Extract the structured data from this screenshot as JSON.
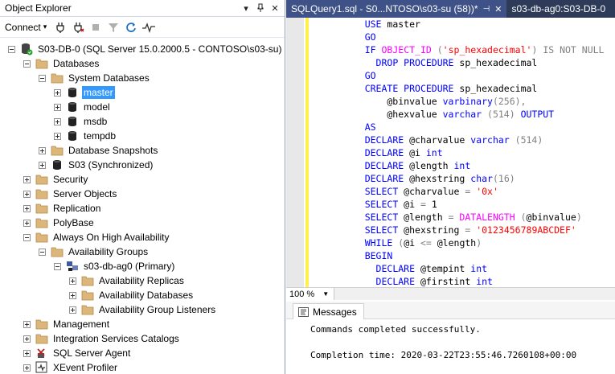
{
  "object_explorer": {
    "title": "Object Explorer",
    "connect_label": "Connect",
    "tree": [
      {
        "label": "S03-DB-0 (SQL Server 15.0.2000.5 - CONTOSO\\s03-su)",
        "icon": "server-icon",
        "depth": 0,
        "expander": "minus"
      },
      {
        "label": "Databases",
        "icon": "folder-icon",
        "depth": 1,
        "expander": "minus"
      },
      {
        "label": "System Databases",
        "icon": "folder-icon",
        "depth": 2,
        "expander": "minus"
      },
      {
        "label": "master",
        "icon": "database-icon",
        "depth": 3,
        "expander": "plus",
        "selected": true
      },
      {
        "label": "model",
        "icon": "database-icon",
        "depth": 3,
        "expander": "plus"
      },
      {
        "label": "msdb",
        "icon": "database-icon",
        "depth": 3,
        "expander": "plus"
      },
      {
        "label": "tempdb",
        "icon": "database-icon",
        "depth": 3,
        "expander": "plus"
      },
      {
        "label": "Database Snapshots",
        "icon": "folder-icon",
        "depth": 2,
        "expander": "plus"
      },
      {
        "label": "S03 (Synchronized)",
        "icon": "database-icon",
        "depth": 2,
        "expander": "plus"
      },
      {
        "label": "Security",
        "icon": "folder-icon",
        "depth": 1,
        "expander": "plus"
      },
      {
        "label": "Server Objects",
        "icon": "folder-icon",
        "depth": 1,
        "expander": "plus"
      },
      {
        "label": "Replication",
        "icon": "folder-icon",
        "depth": 1,
        "expander": "plus"
      },
      {
        "label": "PolyBase",
        "icon": "folder-icon",
        "depth": 1,
        "expander": "plus"
      },
      {
        "label": "Always On High Availability",
        "icon": "folder-icon",
        "depth": 1,
        "expander": "minus"
      },
      {
        "label": "Availability Groups",
        "icon": "folder-icon",
        "depth": 2,
        "expander": "minus"
      },
      {
        "label": "s03-db-ag0 (Primary)",
        "icon": "availability-group-icon",
        "depth": 3,
        "expander": "minus"
      },
      {
        "label": "Availability Replicas",
        "icon": "folder-icon",
        "depth": 4,
        "expander": "plus"
      },
      {
        "label": "Availability Databases",
        "icon": "folder-icon",
        "depth": 4,
        "expander": "plus"
      },
      {
        "label": "Availability Group Listeners",
        "icon": "folder-icon",
        "depth": 4,
        "expander": "plus"
      },
      {
        "label": "Management",
        "icon": "folder-icon",
        "depth": 1,
        "expander": "plus"
      },
      {
        "label": "Integration Services Catalogs",
        "icon": "folder-icon",
        "depth": 1,
        "expander": "plus"
      },
      {
        "label": "SQL Server Agent",
        "icon": "agent-icon",
        "depth": 1,
        "expander": "plus"
      },
      {
        "label": "XEvent Profiler",
        "icon": "profiler-icon",
        "depth": 1,
        "expander": "plus"
      }
    ]
  },
  "tabs": [
    {
      "label": "SQLQuery1.sql - S0...NTOSO\\s03-su (58))*",
      "active": true
    },
    {
      "label": "s03-db-ag0:S03-DB-0",
      "active": false
    }
  ],
  "code_lines": [
    [
      [
        "    ",
        ""
      ],
      [
        "USE",
        "kw"
      ],
      [
        " master",
        ""
      ]
    ],
    [
      [
        "    ",
        ""
      ],
      [
        "GO",
        "kw"
      ]
    ],
    [
      [
        "    ",
        ""
      ],
      [
        "IF",
        "kw"
      ],
      [
        " ",
        ""
      ],
      [
        "OBJECT_ID",
        "fn"
      ],
      [
        " (",
        "gr"
      ],
      [
        "'sp_hexadecimal'",
        "str"
      ],
      [
        ") ",
        "gr"
      ],
      [
        "IS NOT NULL",
        "gr"
      ]
    ],
    [
      [
        "      ",
        ""
      ],
      [
        "DROP PROCEDURE",
        "kw"
      ],
      [
        " sp_hexadecimal",
        ""
      ]
    ],
    [
      [
        "    ",
        ""
      ],
      [
        "GO",
        "kw"
      ]
    ],
    [
      [
        "    ",
        ""
      ],
      [
        "CREATE PROCEDURE",
        "kw"
      ],
      [
        " sp_hexadecimal",
        ""
      ]
    ],
    [
      [
        "        @binvalue ",
        ""
      ],
      [
        "varbinary",
        "kw"
      ],
      [
        "(256),",
        "gr"
      ]
    ],
    [
      [
        "        @hexvalue ",
        ""
      ],
      [
        "varchar",
        "kw"
      ],
      [
        " (514) ",
        "gr"
      ],
      [
        "OUTPUT",
        "kw"
      ]
    ],
    [
      [
        "    ",
        ""
      ],
      [
        "AS",
        "kw"
      ]
    ],
    [
      [
        "    ",
        ""
      ],
      [
        "DECLARE",
        "kw"
      ],
      [
        " @charvalue ",
        ""
      ],
      [
        "varchar",
        "kw"
      ],
      [
        " (514)",
        "gr"
      ]
    ],
    [
      [
        "    ",
        ""
      ],
      [
        "DECLARE",
        "kw"
      ],
      [
        " @i ",
        ""
      ],
      [
        "int",
        "kw"
      ]
    ],
    [
      [
        "    ",
        ""
      ],
      [
        "DECLARE",
        "kw"
      ],
      [
        " @length ",
        ""
      ],
      [
        "int",
        "kw"
      ]
    ],
    [
      [
        "    ",
        ""
      ],
      [
        "DECLARE",
        "kw"
      ],
      [
        " @hexstring ",
        ""
      ],
      [
        "char",
        "kw"
      ],
      [
        "(16)",
        "gr"
      ]
    ],
    [
      [
        "    ",
        ""
      ],
      [
        "SELECT",
        "kw"
      ],
      [
        " @charvalue ",
        ""
      ],
      [
        "= ",
        "gr"
      ],
      [
        "'0x'",
        "str"
      ]
    ],
    [
      [
        "    ",
        ""
      ],
      [
        "SELECT",
        "kw"
      ],
      [
        " @i ",
        ""
      ],
      [
        "= ",
        "gr"
      ],
      [
        "1",
        ""
      ]
    ],
    [
      [
        "    ",
        ""
      ],
      [
        "SELECT",
        "kw"
      ],
      [
        " @length ",
        ""
      ],
      [
        "= ",
        "gr"
      ],
      [
        "DATALENGTH",
        "fn"
      ],
      [
        " (",
        "gr"
      ],
      [
        "@binvalue",
        ""
      ],
      [
        ")",
        "gr"
      ]
    ],
    [
      [
        "    ",
        ""
      ],
      [
        "SELECT",
        "kw"
      ],
      [
        " @hexstring ",
        ""
      ],
      [
        "= ",
        "gr"
      ],
      [
        "'0123456789ABCDEF'",
        "str"
      ]
    ],
    [
      [
        "    ",
        ""
      ],
      [
        "WHILE",
        "kw"
      ],
      [
        " (",
        "gr"
      ],
      [
        "@i ",
        ""
      ],
      [
        "<= ",
        "gr"
      ],
      [
        "@length",
        ""
      ],
      [
        ")",
        "gr"
      ]
    ],
    [
      [
        "    ",
        ""
      ],
      [
        "BEGIN",
        "kw"
      ]
    ],
    [
      [
        "      ",
        ""
      ],
      [
        "DECLARE",
        "kw"
      ],
      [
        " @tempint ",
        ""
      ],
      [
        "int",
        "kw"
      ]
    ],
    [
      [
        "      ",
        ""
      ],
      [
        "DECLARE",
        "kw"
      ],
      [
        " @firstint ",
        ""
      ],
      [
        "int",
        "kw"
      ]
    ]
  ],
  "status": {
    "zoom": "100 %"
  },
  "messages": {
    "tab_label": "Messages",
    "lines": [
      "Commands completed successfully.",
      "",
      "Completion time: 2020-03-22T23:55:46.7260108+00:00"
    ]
  }
}
